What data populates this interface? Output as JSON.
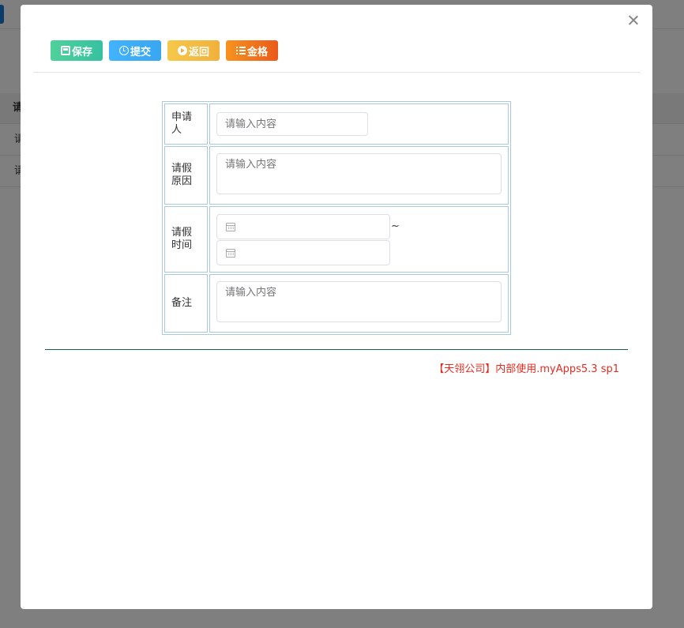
{
  "background": {
    "table_header": "请",
    "rows": [
      "请",
      "请"
    ]
  },
  "toolbar": {
    "save_label": "保存",
    "submit_label": "提交",
    "back_label": "返回",
    "grid_label": "金格"
  },
  "form": {
    "applicant_label": "申请人",
    "applicant_placeholder": "请输入内容",
    "reason_label": "请假原因",
    "reason_placeholder": "请输入内容",
    "time_label": "请假时间",
    "range_separator": "~",
    "remark_label": "备注",
    "remark_placeholder": "请输入内容"
  },
  "footer": {
    "text": "【天翎公司】内部使用.myApps5.3 sp1"
  },
  "colors": {
    "save": "#3fc99d",
    "submit": "#40affa",
    "back": "#f3bf45",
    "grid": "#ef6b1c",
    "footer_text": "#e8291e",
    "table_border": "#a8c8e6"
  },
  "icons": [
    "save-icon",
    "clock-icon",
    "play-circle-icon",
    "list-icon",
    "close-icon",
    "calendar-icon"
  ]
}
